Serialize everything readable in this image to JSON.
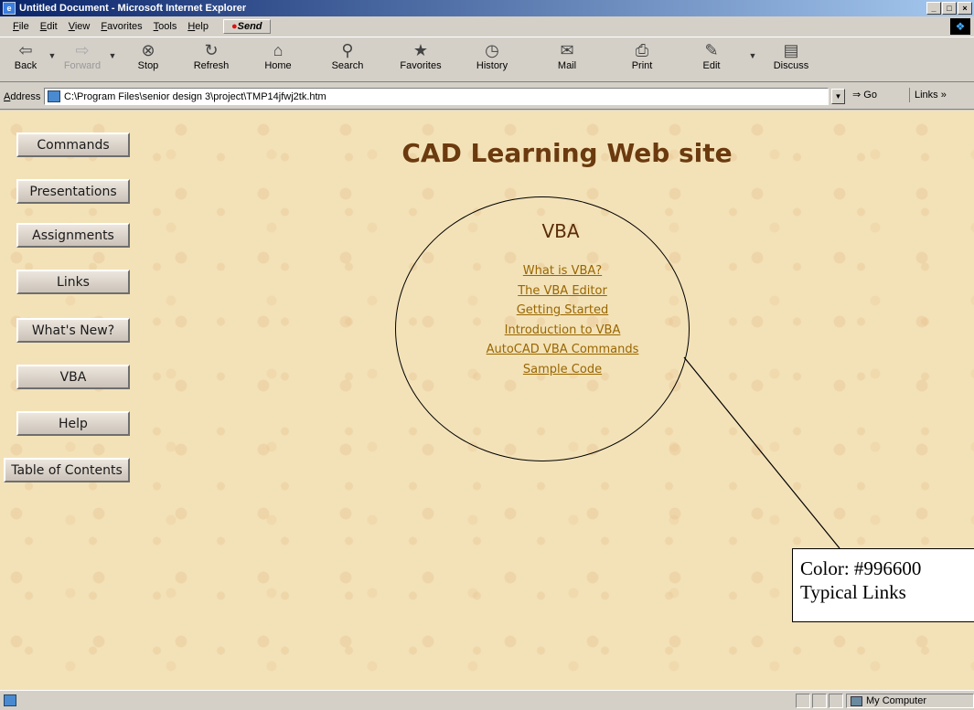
{
  "window": {
    "title": "Untitled Document - Microsoft Internet Explorer",
    "controls": [
      "_",
      "□",
      "×"
    ]
  },
  "menu": {
    "items": [
      "File",
      "Edit",
      "View",
      "Favorites",
      "Tools",
      "Help"
    ],
    "send_label": "Send"
  },
  "toolbar": {
    "buttons": [
      {
        "label": "Back",
        "icon": "back-arrow-icon"
      },
      {
        "label": "Forward",
        "icon": "forward-arrow-icon",
        "disabled": true
      },
      {
        "label": "Stop",
        "icon": "stop-icon"
      },
      {
        "label": "Refresh",
        "icon": "refresh-icon"
      },
      {
        "label": "Home",
        "icon": "home-icon"
      },
      {
        "label": "Search",
        "icon": "search-icon"
      },
      {
        "label": "Favorites",
        "icon": "favorites-icon"
      },
      {
        "label": "History",
        "icon": "history-icon"
      },
      {
        "label": "Mail",
        "icon": "mail-icon"
      },
      {
        "label": "Print",
        "icon": "print-icon"
      },
      {
        "label": "Edit",
        "icon": "edit-icon"
      },
      {
        "label": "Discuss",
        "icon": "discuss-icon"
      }
    ]
  },
  "address": {
    "label": "Address",
    "url": "C:\\Program Files\\senior design 3\\project\\TMP14jfwj2tk.htm",
    "go_label": "Go",
    "links_label": "Links »"
  },
  "page": {
    "title": "CAD Learning Web site",
    "nav_buttons": [
      "Commands",
      "Presentations",
      "Assignments",
      "Links",
      "What's New?",
      "VBA",
      "Help",
      "Table of Contents"
    ],
    "vba_heading": "VBA",
    "vba_links": [
      "What is VBA?",
      "The VBA Editor",
      "Getting Started",
      "Introduction to VBA",
      "AutoCAD VBA Commands",
      "Sample Code"
    ],
    "link_color": "#996600"
  },
  "callout": {
    "line1": "Color: #996600",
    "line2": "Typical Links"
  },
  "status": {
    "zone": "My Computer"
  }
}
